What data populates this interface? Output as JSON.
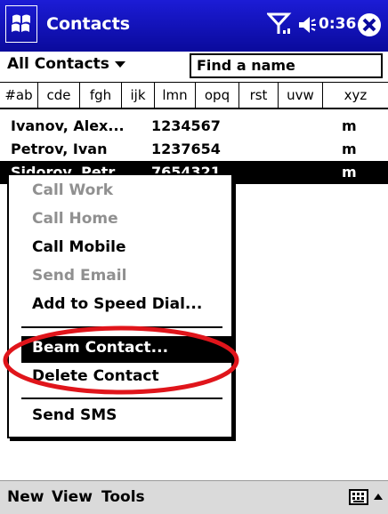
{
  "title_bar": {
    "app_title": "Contacts",
    "clock": "0:36"
  },
  "filter": {
    "dropdown_label": "All Contacts",
    "find_placeholder": "Find a name"
  },
  "tabs": [
    "#ab",
    "cde",
    "fgh",
    "ijk",
    "lmn",
    "opq",
    "rst",
    "uvw",
    "xyz"
  ],
  "contacts": [
    {
      "name": "Ivanov, Alex...",
      "phone": "1234567",
      "type": "m"
    },
    {
      "name": "Petrov, Ivan",
      "phone": "1237654",
      "type": "m"
    },
    {
      "name": "Sidorov, Petr",
      "phone": "7654321",
      "type": "m",
      "selected": true
    }
  ],
  "context_menu": {
    "call_work": "Call Work",
    "call_home": "Call Home",
    "call_mobile": "Call Mobile",
    "send_email": "Send Email",
    "add_speed_dial": "Add to Speed Dial...",
    "beam_contact": "Beam Contact...",
    "delete_contact": "Delete Contact",
    "send_sms": "Send SMS"
  },
  "menu_bar": {
    "new": "New",
    "view": "View",
    "tools": "Tools"
  },
  "icons": {
    "start": "windows-flag-icon",
    "signal": "signal-icon",
    "volume": "volume-icon",
    "close": "close-icon",
    "keyboard": "keyboard-icon",
    "sip": "sip-arrow-icon"
  },
  "colors": {
    "title_bar": "#0a0a9c",
    "annotation": "#e0151b",
    "disabled_text": "#909090"
  }
}
